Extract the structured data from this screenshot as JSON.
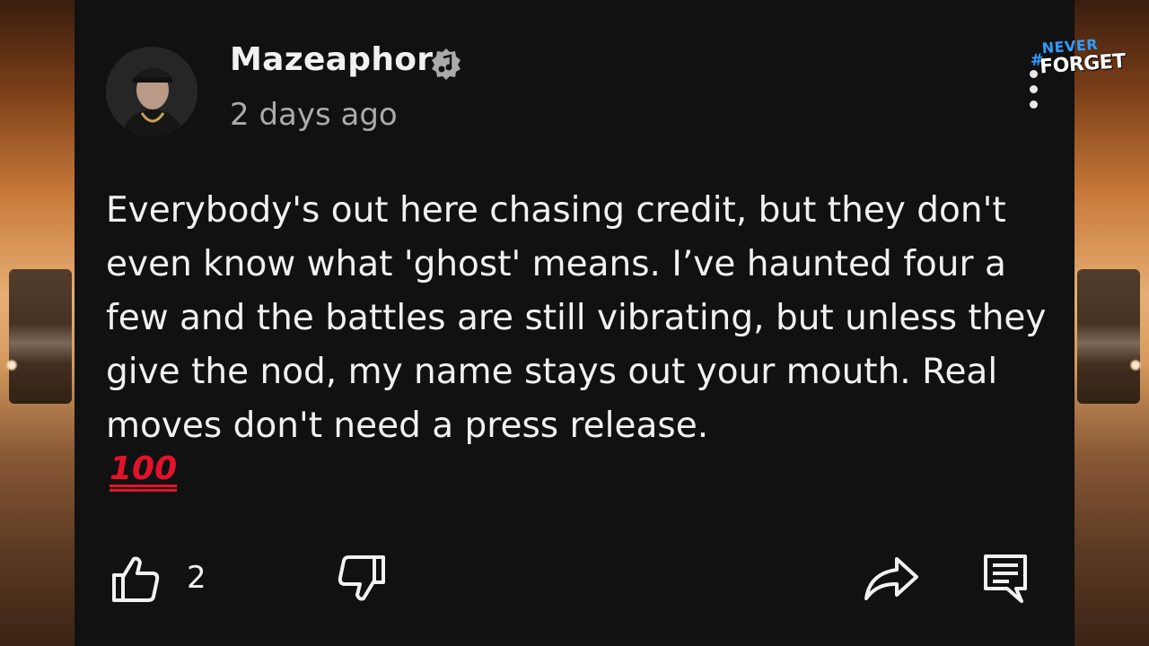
{
  "comment": {
    "author": "Mazeaphor",
    "verified_icon": "music-note-verified-icon",
    "timestamp": "2 days ago",
    "text": "Everybody's out here chasing credit, but they don't even know what 'ghost' means. I’ve haunted four a few and the battles are still vibrating, but unless they give the nod, my name stays out your mouth. Real moves don't need a press release.",
    "emoji": "100",
    "like_count": "2"
  },
  "overlay_badge": {
    "hash": "#",
    "line1": "NEVER",
    "line2": "FORGET"
  },
  "actions": {
    "like_icon": "thumbs-up-icon",
    "dislike_icon": "thumbs-down-icon",
    "share_icon": "share-icon",
    "reply_icon": "reply-icon",
    "more_icon": "more-vertical-icon"
  },
  "colors": {
    "panel_bg": "#111111",
    "text_primary": "#f1f1f1",
    "text_secondary": "#aaaaaa",
    "emoji_red": "#e3122b",
    "badge_blue": "#2f9cff"
  }
}
